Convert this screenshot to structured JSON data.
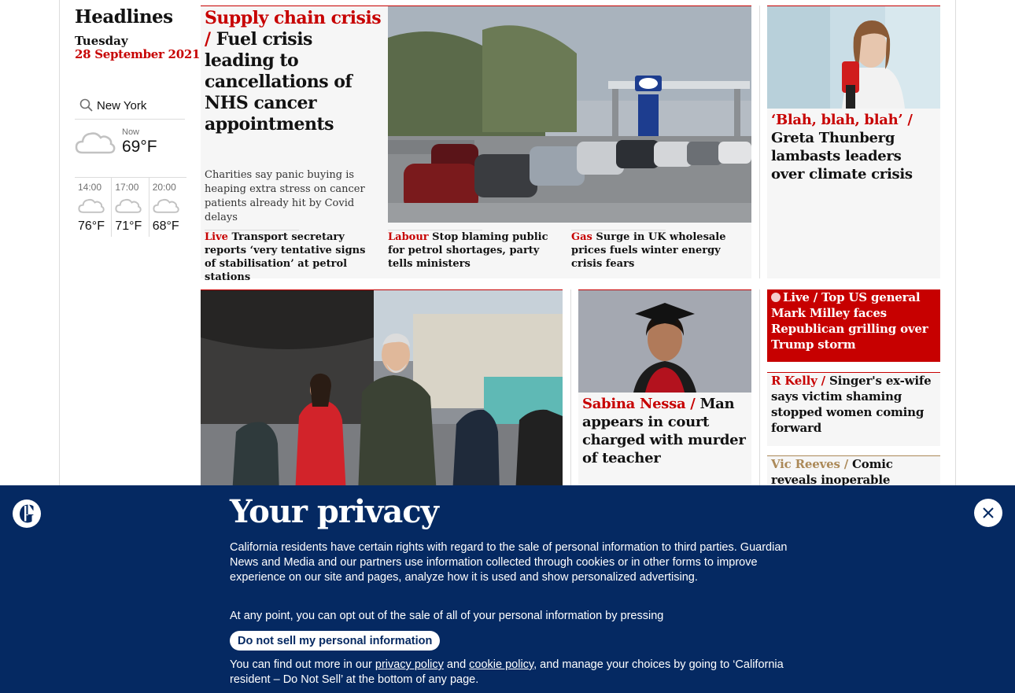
{
  "sidebar": {
    "title": "Headlines",
    "day": "Tuesday",
    "date": "28 September 2021",
    "search_value": "New York",
    "now_label": "Now",
    "now_temp": "69°F",
    "forecast": [
      {
        "time": "14:00",
        "temp": "76°F"
      },
      {
        "time": "17:00",
        "temp": "71°F"
      },
      {
        "time": "20:00",
        "temp": "68°F"
      }
    ]
  },
  "lead": {
    "kicker": "Supply chain crisis /",
    "headline": "Fuel crisis leading to cancellations of NHS cancer appointments",
    "standfirst": "Charities say panic buying is heaping extra stress on cancer patients already hit by Covid delays",
    "sublinks": [
      {
        "kicker": "Live",
        "text": "Transport secretary reports ‘very tentative signs of stabilisation’ at petrol stations"
      },
      {
        "kicker": "Labour",
        "text": "Stop blaming public for petrol shortages, party tells ministers"
      },
      {
        "kicker": "Gas",
        "text": "Surge in UK wholesale prices fuels winter energy crisis fears"
      }
    ]
  },
  "greta": {
    "kicker": "‘Blah, blah, blah’ /",
    "headline": "Greta Thunberg lambasts leaders over climate crisis"
  },
  "sabina": {
    "kicker": "Sabina Nessa /",
    "headline": "Man appears in court charged with murder of teacher"
  },
  "live_card": {
    "kicker": "Live /",
    "headline": "Top US general Mark Milley faces Republican grilling over Trump storm"
  },
  "rkelly": {
    "kicker": "R Kelly /",
    "headline": "Singer's ex-wife says victim shaming stopped women coming forward"
  },
  "vic": {
    "kicker": "Vic Reeves /",
    "headline": "Comic reveals inoperable tumour has left"
  },
  "privacy": {
    "title": "Your privacy",
    "p1": "California residents have certain rights with regard to the sale of personal information to third parties. Guardian News and Media and our partners use information collected through cookies or in other forms to improve experience on our site and pages, analyze how it is used and show personalized advertising.",
    "p2": "At any point, you can opt out of the sale of all of your personal information by pressing",
    "button": "Do not sell my personal information",
    "p3_a": "You can find out more in our ",
    "privacy_link": "privacy policy",
    "p3_b": " and ",
    "cookie_link": "cookie policy",
    "p3_c": ", and manage your choices by going to ‘California resident – Do Not Sell’ at the bottom of any page."
  },
  "colors": {
    "news_red": "#c70000",
    "privacy_blue": "#052962",
    "culture_gold": "#ab8958"
  }
}
